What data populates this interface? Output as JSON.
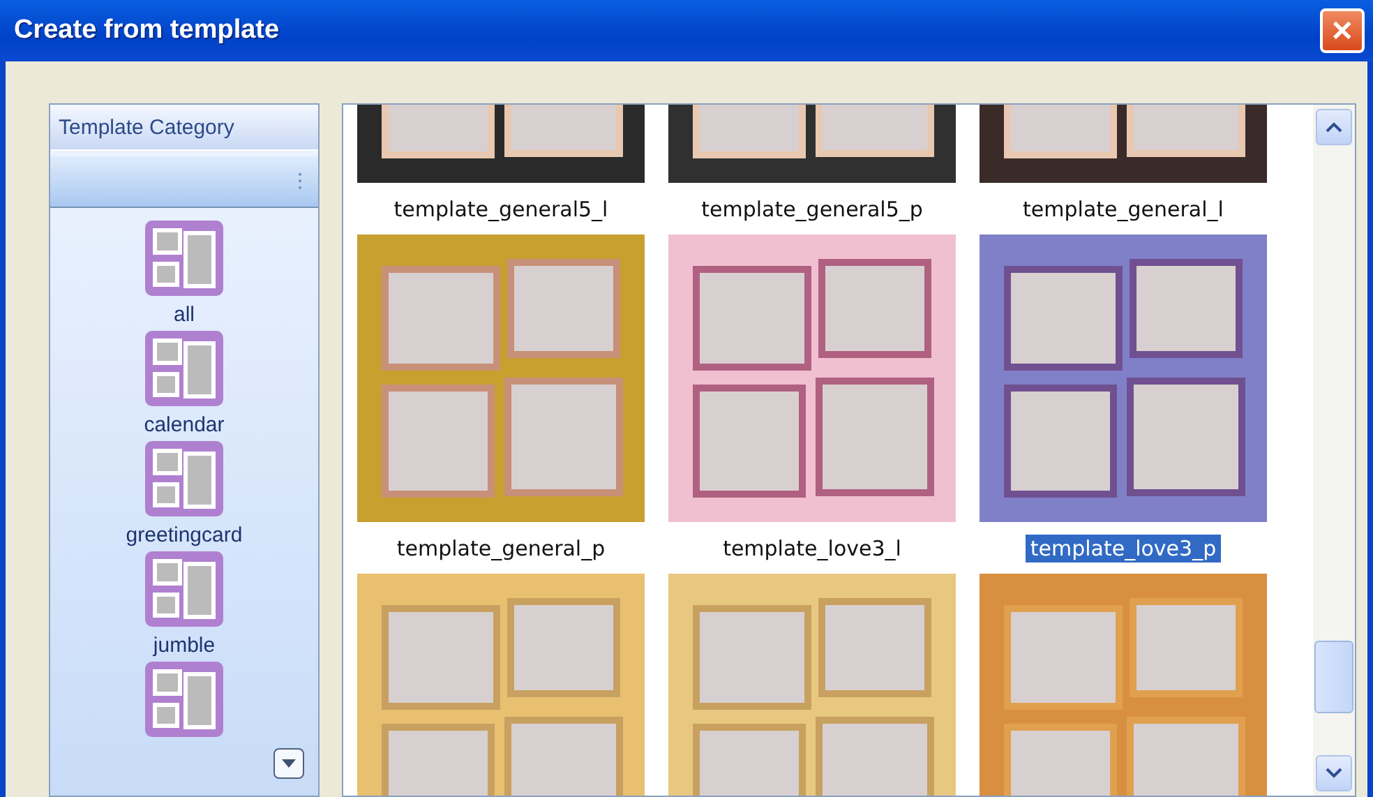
{
  "window": {
    "title": "Create from template",
    "close": "✕"
  },
  "sidebar": {
    "title": "Template Category",
    "grip": "⋮",
    "categories": [
      {
        "label": "all"
      },
      {
        "label": "calendar"
      },
      {
        "label": "greetingcard"
      },
      {
        "label": "jumble"
      }
    ]
  },
  "templates": [
    {
      "label": "template_general5_l",
      "selected": false
    },
    {
      "label": "template_general5_p",
      "selected": false
    },
    {
      "label": "template_general_l",
      "selected": false
    },
    {
      "label": "template_general_p",
      "selected": false
    },
    {
      "label": "template_love3_l",
      "selected": false
    },
    {
      "label": "template_love3_p",
      "selected": true
    }
  ]
}
